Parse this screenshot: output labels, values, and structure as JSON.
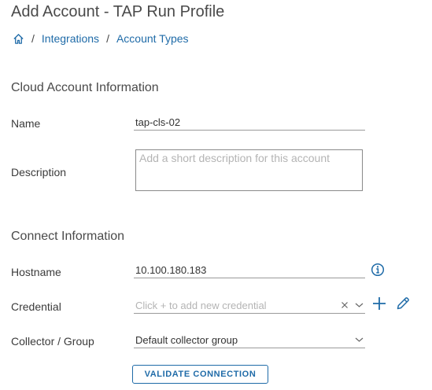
{
  "page": {
    "title": "Add Account - TAP Run Profile"
  },
  "breadcrumb": {
    "items": [
      "Integrations",
      "Account Types"
    ],
    "separator": "/"
  },
  "sections": {
    "cloud": "Cloud Account Information",
    "connect": "Connect Information"
  },
  "fields": {
    "name": {
      "label": "Name",
      "value": "tap-cls-02"
    },
    "description": {
      "label": "Description",
      "placeholder": "Add a short description for this account"
    },
    "hostname": {
      "label": "Hostname",
      "value": "10.100.180.183"
    },
    "credential": {
      "label": "Credential",
      "placeholder": "Click + to add new credential"
    },
    "collector": {
      "label": "Collector / Group",
      "value": "Default collector group"
    }
  },
  "buttons": {
    "validate": "VALIDATE CONNECTION"
  },
  "icons": [
    "home-icon",
    "info-icon",
    "clear-icon",
    "chevron-down-icon",
    "add-icon",
    "edit-icon"
  ],
  "colors": {
    "link": "#1f6ba8",
    "text": "#333333",
    "placeholder": "#b4b4b4"
  }
}
